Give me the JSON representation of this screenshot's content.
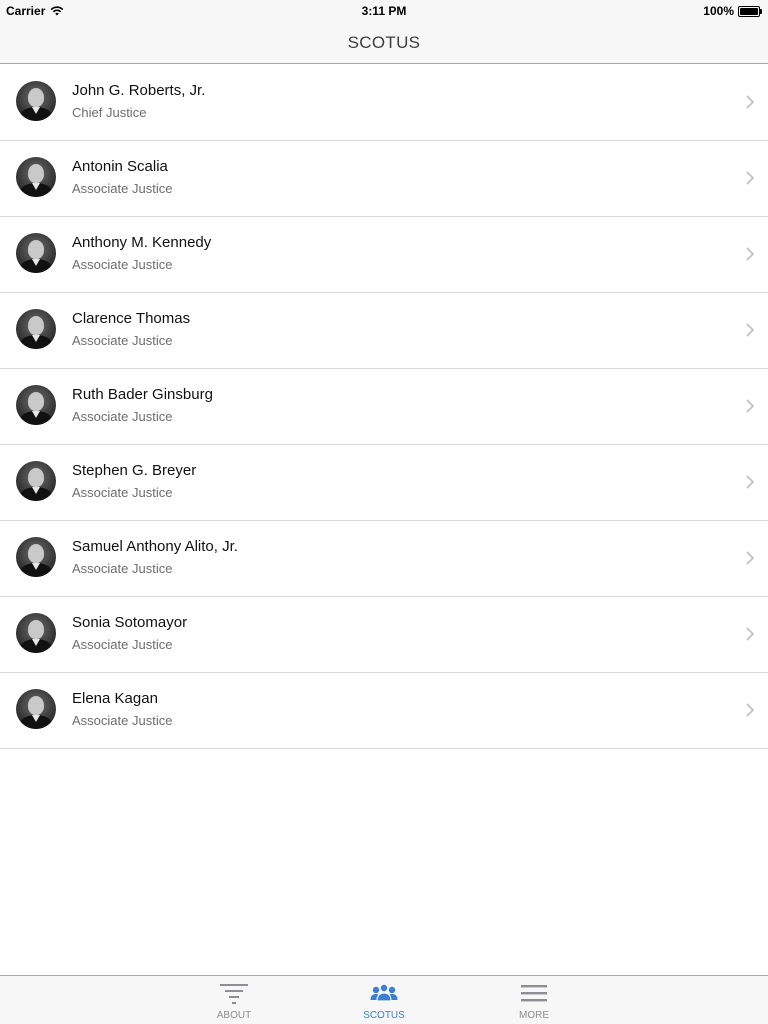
{
  "status_bar": {
    "carrier": "Carrier",
    "time": "3:11 PM",
    "battery": "100%",
    "icons": [
      "wifi-icon",
      "battery-icon"
    ]
  },
  "nav": {
    "title": "SCOTUS"
  },
  "justices": [
    {
      "name": "John G. Roberts, Jr.",
      "title": "Chief Justice"
    },
    {
      "name": "Antonin Scalia",
      "title": "Associate Justice"
    },
    {
      "name": "Anthony M. Kennedy",
      "title": "Associate Justice"
    },
    {
      "name": "Clarence Thomas",
      "title": "Associate Justice"
    },
    {
      "name": "Ruth Bader Ginsburg",
      "title": "Associate Justice"
    },
    {
      "name": "Stephen G. Breyer",
      "title": "Associate Justice"
    },
    {
      "name": "Samuel Anthony Alito, Jr.",
      "title": "Associate Justice"
    },
    {
      "name": "Sonia Sotomayor",
      "title": "Associate Justice"
    },
    {
      "name": "Elena Kagan",
      "title": "Associate Justice"
    }
  ],
  "tabs": [
    {
      "label": "ABOUT",
      "icon": "filter-lines-icon",
      "selected": false
    },
    {
      "label": "SCOTUS",
      "icon": "people-group-icon",
      "selected": true
    },
    {
      "label": "MORE",
      "icon": "menu-lines-icon",
      "selected": false
    }
  ],
  "colors": {
    "accent": "#3a7fd5",
    "inactive_tab": "#8e8e93",
    "bar_background": "#f7f7f7",
    "separator": "#d9d9dd"
  }
}
